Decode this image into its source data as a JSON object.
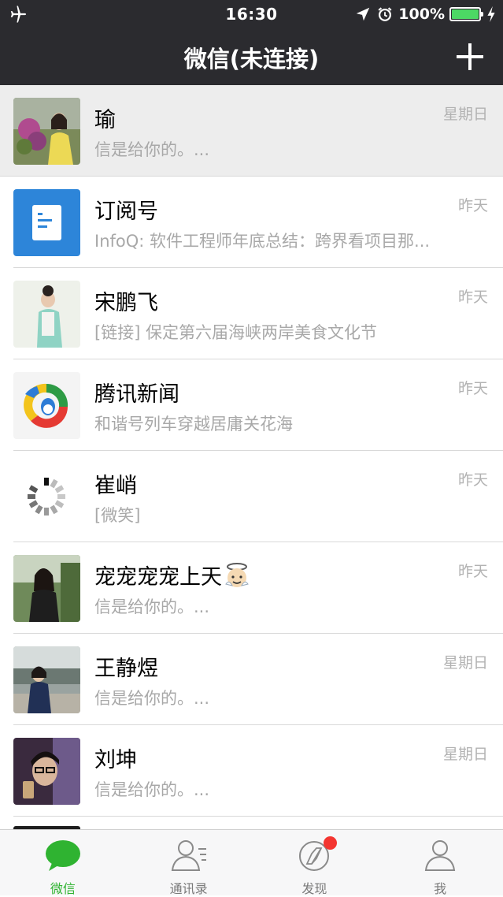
{
  "status_bar": {
    "time": "16:30",
    "battery_percent": "100%",
    "battery_level": 1.0,
    "icons": [
      "airplane-mode-icon",
      "location-arrow-icon",
      "alarm-clock-icon",
      "battery-icon",
      "charging-bolt-icon"
    ]
  },
  "nav": {
    "title": "微信(未连接)",
    "add_icon": "plus-icon"
  },
  "chats": [
    {
      "name": "瑜",
      "time": "星期日",
      "preview": "信是给你的。...",
      "highlighted": true
    },
    {
      "name": "订阅号",
      "time": "昨天",
      "preview": "InfoQ: 软件工程师年底总结：跨界看项目那..."
    },
    {
      "name": "宋鹏飞",
      "time": "昨天",
      "preview": "[链接] 保定第六届海峡两岸美食文化节"
    },
    {
      "name": "腾讯新闻",
      "time": "昨天",
      "preview": "和谐号列车穿越居庸关花海"
    },
    {
      "name": "崔峭",
      "time": "昨天",
      "preview": "[微笑]"
    },
    {
      "name": "宠宠宠宠上天",
      "name_emoji": "angel-emoji-icon",
      "time": "昨天",
      "preview": "信是给你的。..."
    },
    {
      "name": "王静煜",
      "time": "星期日",
      "preview": "信是给你的。..."
    },
    {
      "name": "刘坤",
      "time": "星期日",
      "preview": "信是给你的。..."
    }
  ],
  "tabs": [
    {
      "label": "微信",
      "icon": "chat-bubble-icon",
      "active": true
    },
    {
      "label": "通讯录",
      "icon": "contacts-icon",
      "active": false
    },
    {
      "label": "发现",
      "icon": "compass-icon",
      "active": false,
      "badge": "red-dot"
    },
    {
      "label": "我",
      "icon": "person-icon",
      "active": false
    }
  ],
  "colors": {
    "header_bg": "#2b2b2f",
    "active_tab": "#2fb331",
    "badge": "#f43530",
    "battery": "#4cd964",
    "secondary_text": "#a8a8a8"
  }
}
